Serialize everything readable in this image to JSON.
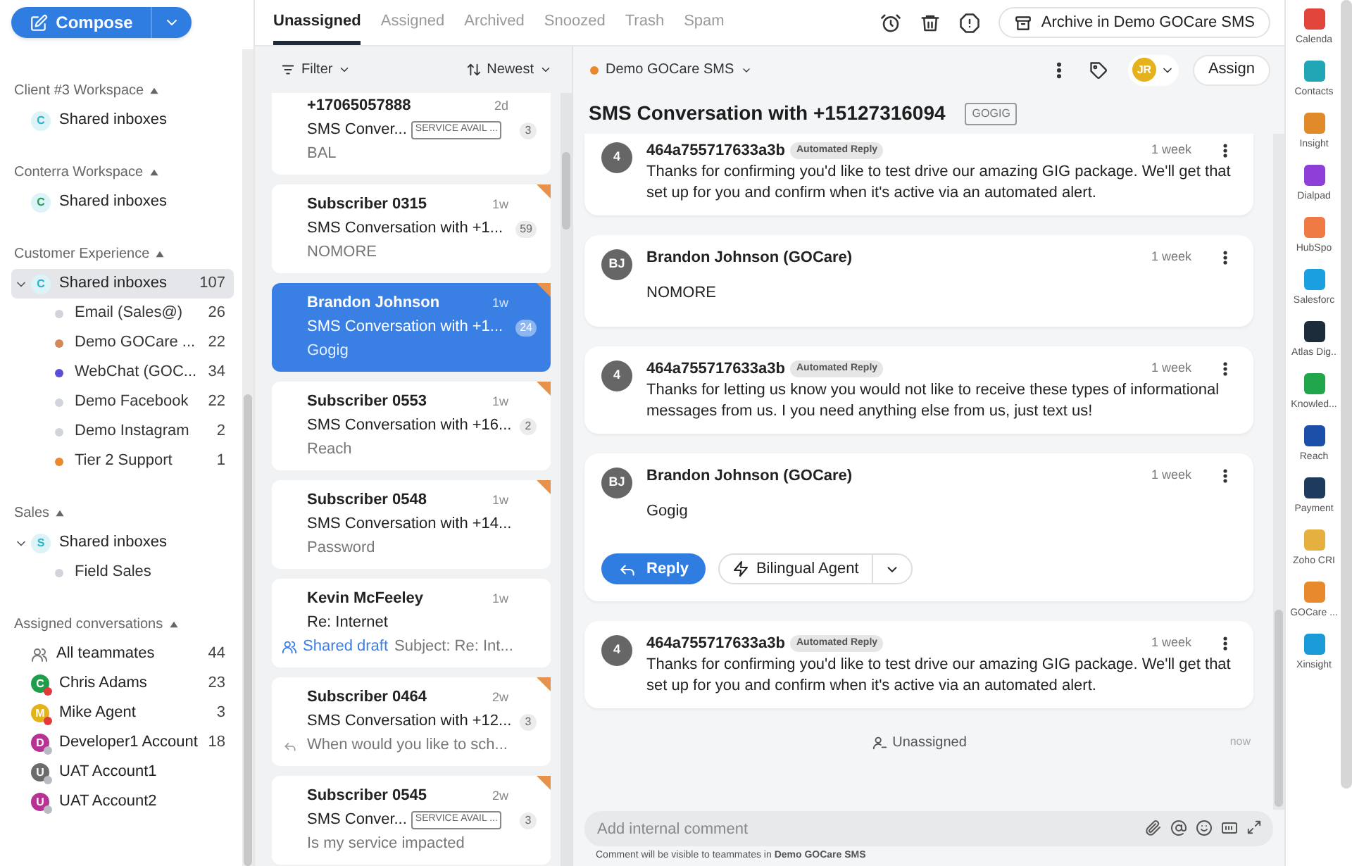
{
  "compose": {
    "label": "Compose"
  },
  "sidebar": {
    "sections": [
      {
        "title": "Client #3 Workspace",
        "items": [
          {
            "kind": "inbox",
            "avatar": "C",
            "color": "#2bb3c9",
            "label": "Shared inboxes",
            "expanded": false,
            "selected": false
          }
        ]
      },
      {
        "title": "Conterra Workspace",
        "items": [
          {
            "kind": "inbox",
            "avatar": "C",
            "color": "#22a05a",
            "label": "Shared inboxes",
            "expanded": false,
            "selected": false
          }
        ]
      },
      {
        "title": "Customer Experience",
        "items": [
          {
            "kind": "inbox",
            "avatar": "C",
            "color": "#2bb3c9",
            "label": "Shared inboxes",
            "count": "107",
            "expanded": true,
            "selected": true,
            "children": [
              {
                "kind": "channel",
                "color": "#d1d5db",
                "label": "Email (Sales@)",
                "count": "26",
                "selected": false
              },
              {
                "kind": "channel",
                "color": "#d4895a",
                "label": "Demo GOCare ...",
                "count": "22",
                "selected": false
              },
              {
                "kind": "channel",
                "color": "#5b4fd6",
                "label": "WebChat (GOC...",
                "count": "34",
                "selected": false
              },
              {
                "kind": "channel",
                "color": "#d1d5db",
                "label": "Demo Facebook",
                "count": "22",
                "selected": false
              },
              {
                "kind": "channel",
                "color": "#d1d5db",
                "label": "Demo Instagram",
                "count": "2",
                "selected": false
              },
              {
                "kind": "channel",
                "color": "#e8892e",
                "label": "Tier 2 Support",
                "count": "1",
                "selected": false
              }
            ]
          }
        ]
      },
      {
        "title": "Sales",
        "items": [
          {
            "kind": "inbox",
            "avatar": "S",
            "color": "#2bb3c9",
            "label": "Shared inboxes",
            "expanded": true,
            "selected": false,
            "children": [
              {
                "kind": "channel",
                "color": "#d1d5db",
                "label": "Field Sales",
                "selected": false
              }
            ]
          }
        ]
      },
      {
        "title": "Assigned conversations",
        "items": [
          {
            "kind": "team",
            "label": "All teammates",
            "count": "44",
            "selected": false
          },
          {
            "kind": "teammate",
            "avatar": "C",
            "color": "#1e9e4a",
            "status_dot": {
              "color": "#e03a3a"
            },
            "label": "Chris Adams",
            "count": "23",
            "selected": false
          },
          {
            "kind": "teammate",
            "avatar": "M",
            "color": "#e3b31c",
            "status_dot": {
              "color": "#e03a3a"
            },
            "label": "Mike Agent",
            "count": "3",
            "selected": false
          },
          {
            "kind": "teammate",
            "avatar": "D",
            "color": "#b83294",
            "status_dot": {
              "color": "#b8bcc2"
            },
            "label": "Developer1 Account",
            "count": "18",
            "selected": false
          },
          {
            "kind": "teammate",
            "avatar": "U",
            "color": "#6b6b6b",
            "status_dot": {
              "color": "#b8bcc2"
            },
            "label": "UAT Account1",
            "selected": false
          },
          {
            "kind": "teammate",
            "avatar": "U",
            "color": "#b83294",
            "status_dot": {
              "color": "#b8bcc2"
            },
            "label": "UAT Account2",
            "selected": false
          }
        ]
      }
    ]
  },
  "tabs": [
    {
      "label": "Unassigned",
      "selected": true
    },
    {
      "label": "Assigned",
      "selected": false
    },
    {
      "label": "Archived",
      "selected": false
    },
    {
      "label": "Snoozed",
      "selected": false
    },
    {
      "label": "Trash",
      "selected": false
    },
    {
      "label": "Spam",
      "selected": false
    }
  ],
  "toolbar": {
    "archive_button": "Archive in Demo GOCare SMS"
  },
  "list_header": {
    "filter": "Filter",
    "sort": "Newest"
  },
  "conversations": [
    {
      "name": "+17065057888",
      "time": "2d",
      "subject": "SMS Conver...",
      "tag": "SERVICE AVAIL ...",
      "count": "3",
      "preview": "BAL",
      "kind": "text",
      "flagged": false,
      "selected": false
    },
    {
      "name": "Subscriber 0315",
      "time": "1w",
      "subject": "SMS Conversation with +1...",
      "count": "59",
      "preview": "NOMORE",
      "kind": "text",
      "flagged": true,
      "selected": false
    },
    {
      "name": "Brandon Johnson",
      "time": "1w",
      "subject": "SMS Conversation with +1...",
      "count": "24",
      "preview": "Gogig",
      "kind": "text",
      "flagged": true,
      "selected": true
    },
    {
      "name": "Subscriber 0553",
      "time": "1w",
      "subject": "SMS Conversation with +16...",
      "count": "2",
      "preview": "Reach",
      "kind": "text",
      "flagged": true,
      "selected": false
    },
    {
      "name": "Subscriber 0548",
      "time": "1w",
      "subject": "SMS Conversation with +14...",
      "preview": "Password",
      "kind": "text",
      "flagged": true,
      "selected": false
    },
    {
      "name": "Kevin McFeeley",
      "time": "1w",
      "subject": "Re: Internet",
      "draft_label": "Shared draft",
      "preview": "Subject: Re: Int...",
      "kind": "draft",
      "flagged": false,
      "selected": false
    },
    {
      "name": "Subscriber 0464",
      "time": "2w",
      "subject": "SMS Conversation with +12...",
      "count": "3",
      "preview": "When would you like to sch...",
      "kind": "replied",
      "flagged": true,
      "selected": false
    },
    {
      "name": "Subscriber 0545",
      "time": "2w",
      "subject": "SMS Conver...",
      "tag": "SERVICE AVAIL ...",
      "count": "3",
      "preview": "Is my service impacted",
      "kind": "text",
      "flagged": true,
      "selected": false
    }
  ],
  "conversation": {
    "inbox": "Demo GOCare SMS",
    "inbox_dot": {
      "color": "#e8892e"
    },
    "assignee": "JR",
    "assign_button": "Assign",
    "title": "SMS Conversation with +15127316094",
    "tag": "GOGIG",
    "messages": [
      {
        "avatar": "4",
        "sender": "464a755717633a3b",
        "badge": "Automated Reply",
        "time": "1 week",
        "body": "Thanks for confirming you'd like to test drive our amazing GIG package. We'll get that set up for you and confirm when it's active via an automated alert."
      },
      {
        "avatar": "BJ",
        "sender": "Brandon Johnson (GOCare)",
        "time": "1 week",
        "body": "NOMORE"
      },
      {
        "avatar": "4",
        "sender": "464a755717633a3b",
        "badge": "Automated Reply",
        "time": "1 week",
        "body": "Thanks for letting us know you would not like to receive these types of informational messages from us.  I you need anything else from us, just text us!"
      },
      {
        "avatar": "BJ",
        "sender": "Brandon Johnson (GOCare)",
        "time": "1 week",
        "body": "Gogig",
        "actions": {
          "reply": "Reply",
          "agent": "Bilingual Agent"
        }
      },
      {
        "avatar": "4",
        "sender": "464a755717633a3b",
        "badge": "Automated Reply",
        "time": "1 week",
        "body": "Thanks for confirming you'd like to test drive our amazing GIG package. We'll get that set up for you and confirm when it's active via an automated alert."
      }
    ],
    "event": {
      "label": "Unassigned",
      "time": "now"
    },
    "composer": {
      "placeholder": "Add internal comment",
      "note": "Comment will be visible to teammates in **Demo GOCare SMS**"
    }
  },
  "apps": [
    {
      "label": "Calenda",
      "color": "#e0443a"
    },
    {
      "label": "Contacts",
      "color": "#21a6b5"
    },
    {
      "label": "Insight",
      "color": "#e08a2a"
    },
    {
      "label": "Dialpad",
      "color": "#8e3fd8"
    },
    {
      "label": "HubSpo",
      "color": "#f07a43"
    },
    {
      "label": "Salesforc",
      "color": "#1aa0e0"
    },
    {
      "label": "Atlas Dig..",
      "color": "#1d2c3a"
    },
    {
      "label": "Knowled...",
      "color": "#21a64b"
    },
    {
      "label": "Reach",
      "color": "#1c4fa8"
    },
    {
      "label": "Payment",
      "color": "#1e3a5c"
    },
    {
      "label": "Zoho CRI",
      "color": "#e6b040"
    },
    {
      "label": "GOCare ...",
      "color": "#e8892e"
    },
    {
      "label": "Xinsight",
      "color": "#1a9ad6"
    }
  ]
}
